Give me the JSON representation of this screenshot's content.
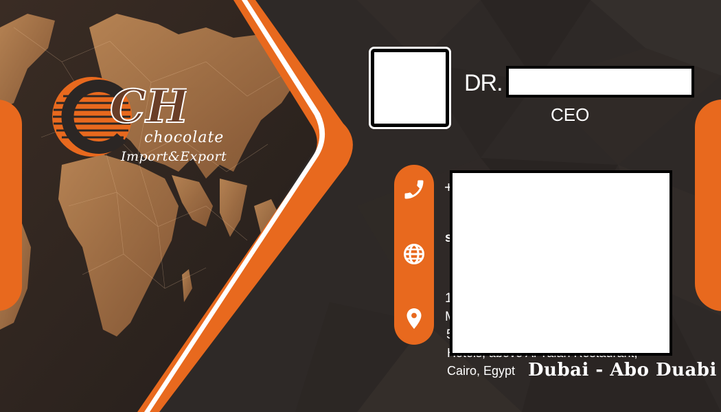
{
  "logo": {
    "monogram": "CH",
    "line1": "chocolate",
    "line2": "Import&Export"
  },
  "person": {
    "title": "DR.",
    "role": "CEO"
  },
  "contact": {
    "phone_prefix": "+",
    "web_prefix": "s",
    "address_line1_prefix": "1",
    "address_line2_prefix": "M",
    "address_line3_prefix": "5",
    "address_line4_partial": "Hotels, above Al Yalan Restaurant,",
    "city": "Cairo, Egypt",
    "branches": "Dubai - Abo Duabi"
  },
  "icons": {
    "phone": "phone-icon",
    "web": "globe-icon",
    "location": "location-pin-icon"
  },
  "colors": {
    "accent": "#e8691e",
    "background": "#2d2826",
    "map": "#b07a4c",
    "text": "#ffffff"
  }
}
